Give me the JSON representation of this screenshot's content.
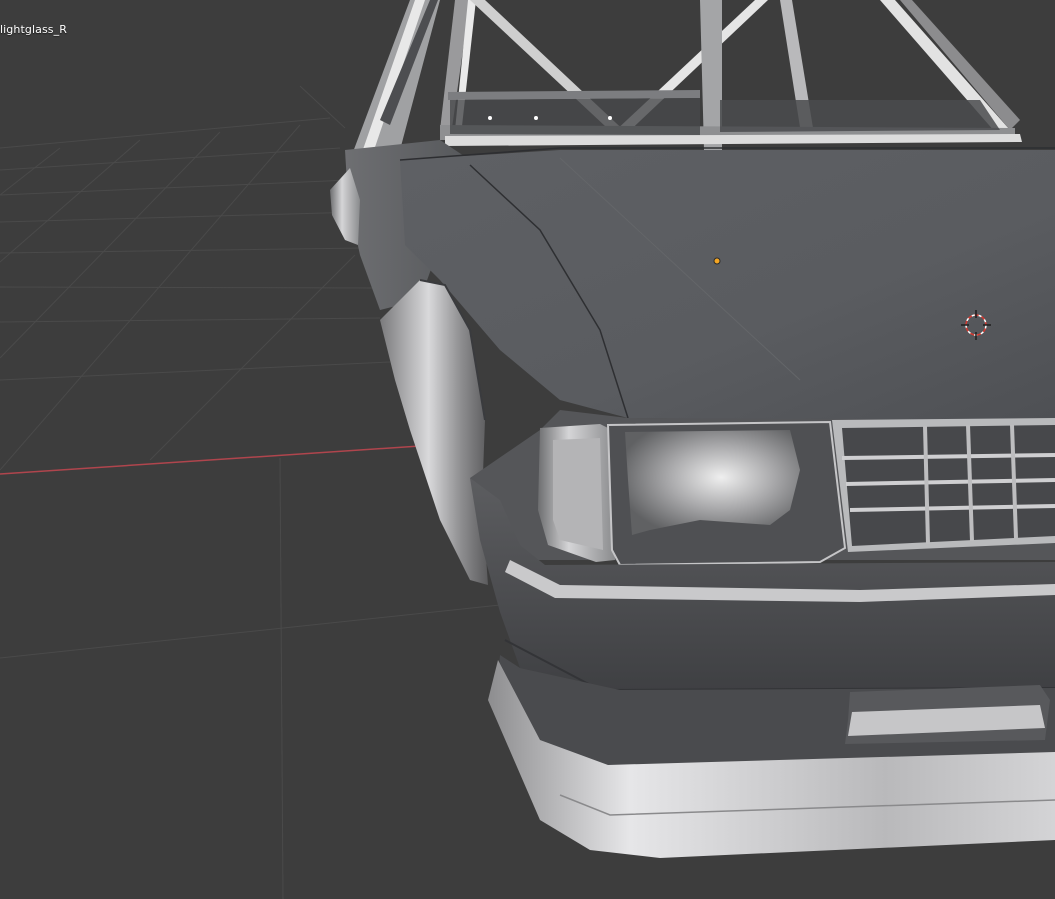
{
  "viewport": {
    "object_name": "lightglass_R",
    "background_color": "#3d3d3d",
    "grid_color": "#4a4a4a",
    "x_axis_color": "#b0454d",
    "origin_color": "#f5a623",
    "cursor_color": "#d8382f"
  }
}
